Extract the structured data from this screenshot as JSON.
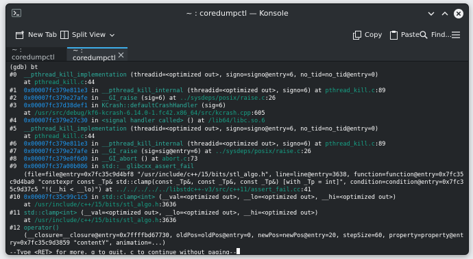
{
  "window": {
    "title": "~ : coredumpctl — Konsole"
  },
  "toolbar": {
    "new_tab_label": "New Tab",
    "split_view_label": "Split View",
    "copy_label": "Copy",
    "paste_label": "Paste",
    "find_label": "Find..."
  },
  "tabs": [
    {
      "label": "~ : coredumpctl",
      "active": false
    },
    {
      "label": "~ : coredumpctl",
      "active": true
    }
  ],
  "terminal": {
    "lines": [
      [
        {
          "t": "(gdb) bt",
          "c": "c-default"
        }
      ],
      [
        {
          "t": "#0  ",
          "c": "c-default"
        },
        {
          "t": "__pthread_kill_implementation",
          "c": "c-fn"
        },
        {
          "t": " (threadid=<optimized out>, signo=signo@entry=6, no_tid=no_tid@entry=0)",
          "c": "c-default"
        }
      ],
      [
        {
          "t": "    at ",
          "c": "c-default"
        },
        {
          "t": "pthread_kill.c",
          "c": "c-path"
        },
        {
          "t": ":44",
          "c": "c-default"
        }
      ],
      [
        {
          "t": "#1  ",
          "c": "c-default"
        },
        {
          "t": "0x00007fc379e811e3",
          "c": "c-addr"
        },
        {
          "t": " in ",
          "c": "c-default"
        },
        {
          "t": "__pthread_kill_internal",
          "c": "c-fn"
        },
        {
          "t": " (threadid=<optimized out>, signo=6) at ",
          "c": "c-default"
        },
        {
          "t": "pthread_kill.c",
          "c": "c-path"
        },
        {
          "t": ":89",
          "c": "c-default"
        }
      ],
      [
        {
          "t": "#2  ",
          "c": "c-default"
        },
        {
          "t": "0x00007fc379e27afe",
          "c": "c-addr"
        },
        {
          "t": " in ",
          "c": "c-default"
        },
        {
          "t": "__GI_raise",
          "c": "c-fn"
        },
        {
          "t": " (sig=6) at ",
          "c": "c-default"
        },
        {
          "t": "../sysdeps/posix/raise.c",
          "c": "c-path"
        },
        {
          "t": ":26",
          "c": "c-default"
        }
      ],
      [
        {
          "t": "#3  ",
          "c": "c-default"
        },
        {
          "t": "0x00007fc37d38def1",
          "c": "c-addr"
        },
        {
          "t": " in ",
          "c": "c-default"
        },
        {
          "t": "KCrash::defaultCrashHandler",
          "c": "c-fn"
        },
        {
          "t": " (sig=6)",
          "c": "c-default"
        }
      ],
      [
        {
          "t": "    at ",
          "c": "c-default"
        },
        {
          "t": "/usr/src/debug/kf6-kcrash-6.14.0-1.fc42.x86_64/src/kcrash.cpp",
          "c": "c-path"
        },
        {
          "t": ":605",
          "c": "c-default"
        }
      ],
      [
        {
          "t": "#4  ",
          "c": "c-default"
        },
        {
          "t": "0x00007fc379e27c30",
          "c": "c-addr"
        },
        {
          "t": " in ",
          "c": "c-default"
        },
        {
          "t": "<signal handler called>",
          "c": "c-fn"
        },
        {
          "t": " () at ",
          "c": "c-default"
        },
        {
          "t": "/lib64/libc.so.6",
          "c": "c-path"
        }
      ],
      [
        {
          "t": "#5  ",
          "c": "c-default"
        },
        {
          "t": "__pthread_kill_implementation",
          "c": "c-fn"
        },
        {
          "t": " (threadid=<optimized out>, signo=signo@entry=6, no_tid=no_tid@entry=0)",
          "c": "c-default"
        }
      ],
      [
        {
          "t": "    at ",
          "c": "c-default"
        },
        {
          "t": "pthread_kill.c",
          "c": "c-path"
        },
        {
          "t": ":44",
          "c": "c-default"
        }
      ],
      [
        {
          "t": "#6  ",
          "c": "c-default"
        },
        {
          "t": "0x00007fc379e811e3",
          "c": "c-addr"
        },
        {
          "t": " in ",
          "c": "c-default"
        },
        {
          "t": "__pthread_kill_internal",
          "c": "c-fn"
        },
        {
          "t": " (threadid=<optimized out>, signo=6) at ",
          "c": "c-default"
        },
        {
          "t": "pthread_kill.c",
          "c": "c-path"
        },
        {
          "t": ":89",
          "c": "c-default"
        }
      ],
      [
        {
          "t": "#7  ",
          "c": "c-default"
        },
        {
          "t": "0x00007fc379e27afe",
          "c": "c-addr"
        },
        {
          "t": " in ",
          "c": "c-default"
        },
        {
          "t": "__GI_raise",
          "c": "c-fn"
        },
        {
          "t": " (sig=sig@entry=6) at ",
          "c": "c-default"
        },
        {
          "t": "../sysdeps/posix/raise.c",
          "c": "c-path"
        },
        {
          "t": ":26",
          "c": "c-default"
        }
      ],
      [
        {
          "t": "#8  ",
          "c": "c-default"
        },
        {
          "t": "0x00007fc379e0f6d0",
          "c": "c-addr"
        },
        {
          "t": " in ",
          "c": "c-default"
        },
        {
          "t": "__GI_abort",
          "c": "c-fn"
        },
        {
          "t": " () at ",
          "c": "c-default"
        },
        {
          "t": "abort.c",
          "c": "c-path"
        },
        {
          "t": ":73",
          "c": "c-default"
        }
      ],
      [
        {
          "t": "#9  ",
          "c": "c-default"
        },
        {
          "t": "0x00007fc37a00b086",
          "c": "c-addr"
        },
        {
          "t": " in ",
          "c": "c-default"
        },
        {
          "t": "std::__glibcxx_assert_fail",
          "c": "c-fn"
        }
      ],
      [
        {
          "t": "    (file=file@entry=0x7fc35c9d4bf8 \"/usr/include/c++/15/bits/stl_algo.h\", line=line@entry=3638, function=function@entry=0x7fc35",
          "c": "c-default"
        }
      ],
      [
        {
          "t": "c9d4ba0 \"constexpr const _Tp& std::clamp(const _Tp&, const _Tp&, const _Tp&) [with _Tp = int]\", condition=condition@entry=0x7fc3",
          "c": "c-default"
        }
      ],
      [
        {
          "t": "5c9d37c5 \"!(__hi < __lo)\") at ",
          "c": "c-default"
        },
        {
          "t": "../../../../../libstdc++-v3/src/c++11/assert_fail.cc",
          "c": "c-path"
        },
        {
          "t": ":41",
          "c": "c-default"
        }
      ],
      [
        {
          "t": "#10 ",
          "c": "c-default"
        },
        {
          "t": "0x00007fc35c99c1c5",
          "c": "c-addr"
        },
        {
          "t": " in ",
          "c": "c-default"
        },
        {
          "t": "std::clamp<int>",
          "c": "c-fn"
        },
        {
          "t": " (__val=<optimized out>, __lo=<optimized out>, __hi=<optimized out>)",
          "c": "c-default"
        }
      ],
      [
        {
          "t": "    at ",
          "c": "c-default"
        },
        {
          "t": "/usr/include/c++/15/bits/stl_algo.h",
          "c": "c-path"
        },
        {
          "t": ":3636",
          "c": "c-default"
        }
      ],
      [
        {
          "t": "#11 ",
          "c": "c-default"
        },
        {
          "t": "std::clamp<int>",
          "c": "c-fn"
        },
        {
          "t": " (__val=<optimized out>, __lo=<optimized out>, __hi=<optimized out>)",
          "c": "c-default"
        }
      ],
      [
        {
          "t": "    at ",
          "c": "c-default"
        },
        {
          "t": "/usr/include/c++/15/bits/stl_algo.h",
          "c": "c-path"
        },
        {
          "t": ":3636",
          "c": "c-default"
        }
      ],
      [
        {
          "t": "#12 ",
          "c": "c-default"
        },
        {
          "t": "operator()",
          "c": "c-fn"
        }
      ],
      [
        {
          "t": "    (__closure=__closure@entry=0x7ffffbd67730, oldPos=oldPos@entry=0, newPos=newPos@entry=20, stepSize=60, property=property@ent",
          "c": "c-default"
        }
      ],
      [
        {
          "t": "ry=0x7fc35c9d3859 \"contentY\", animation=...)",
          "c": "c-default"
        }
      ],
      [
        {
          "t": "--Type <RET> for more, q to quit, c to continue without paging--",
          "c": "c-default"
        }
      ]
    ]
  },
  "colors": {
    "background": "#232629",
    "function": "#2cae9c",
    "address": "#1d99f3",
    "path": "#16a085",
    "text": "#fcfcfc",
    "accent": "#3daee9"
  },
  "icons": {
    "app": "konsole-icon",
    "new_tab": "new-tab-icon",
    "split_view": "split-view-icon",
    "copy": "copy-icon",
    "paste": "paste-icon",
    "find": "search-icon",
    "menu": "hamburger-menu-icon",
    "minimize": "chevron-down-icon",
    "maximize": "chevron-up-icon",
    "close": "close-icon"
  }
}
